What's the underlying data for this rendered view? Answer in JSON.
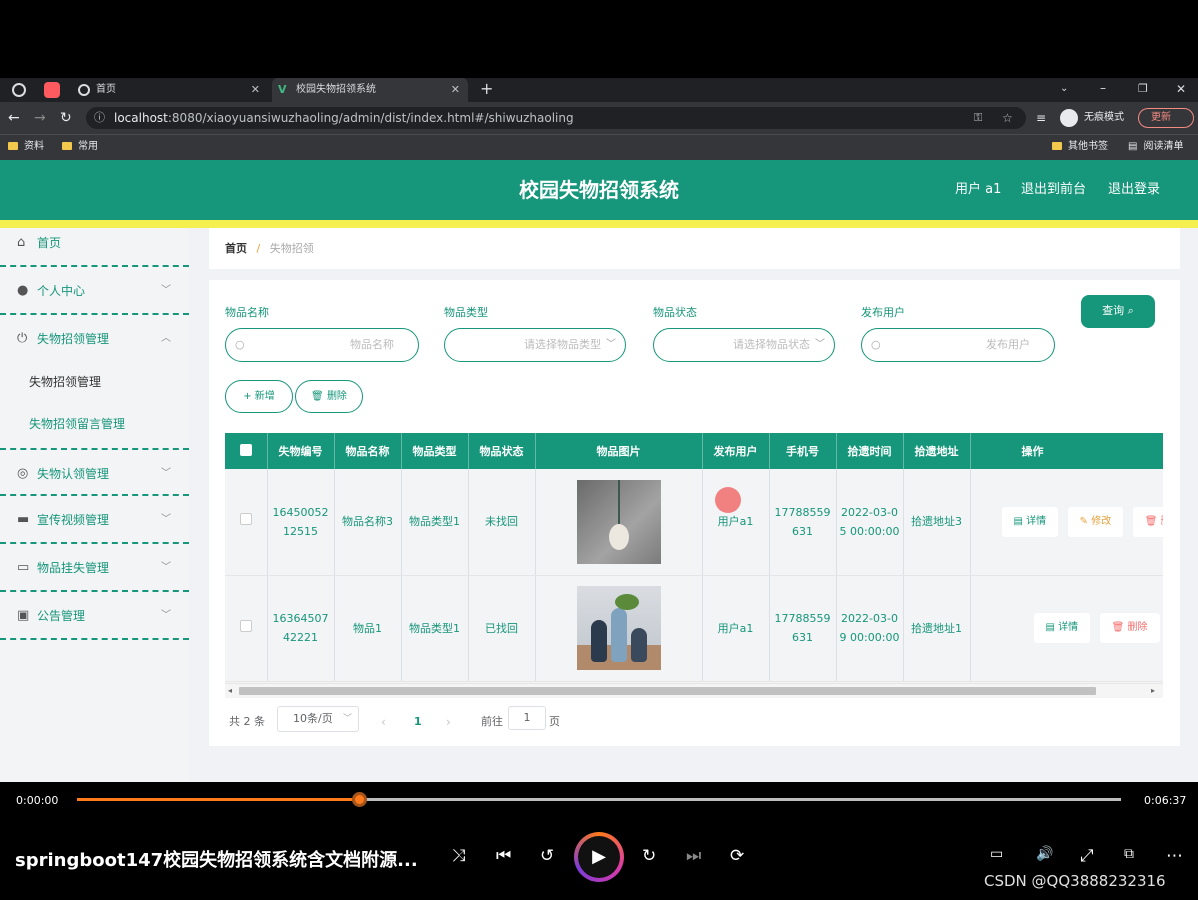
{
  "browser": {
    "tabs": [
      {
        "label": ""
      },
      {
        "label": ""
      },
      {
        "label": "首页"
      },
      {
        "label": "校园失物招领系统"
      }
    ],
    "url_host": "localhost",
    "url_path": ":8080/xiaoyuansiwuzhaoling/admin/dist/index.html#/shiwuzhaoling",
    "incognito_label": "无痕模式",
    "update_label": "更新",
    "bookmarks": [
      "资料",
      "常用"
    ],
    "other_bookmarks": "其他书签",
    "reading_list": "阅读清单"
  },
  "header": {
    "title": "校园失物招领系统",
    "user": "用户 a1",
    "back_front": "退出到前台",
    "logout": "退出登录"
  },
  "sidebar": {
    "items": [
      {
        "label": "首页",
        "icon": "home-icon"
      },
      {
        "label": "个人中心",
        "icon": "user-icon"
      },
      {
        "label": "失物招领管理",
        "icon": "power-icon"
      },
      {
        "label": "失物招领管理",
        "sub": true,
        "active": true
      },
      {
        "label": "失物招领留言管理",
        "sub": true
      },
      {
        "label": "失物认领管理",
        "icon": "target-icon"
      },
      {
        "label": "宣传视频管理",
        "icon": "video-icon"
      },
      {
        "label": "物品挂失管理",
        "icon": "card-icon"
      },
      {
        "label": "公告管理",
        "icon": "clipboard-icon"
      }
    ]
  },
  "breadcrumb": {
    "home": "首页",
    "sep": "/",
    "current": "失物招领"
  },
  "search": {
    "name_label": "物品名称",
    "name_placeholder": "物品名称",
    "type_label": "物品类型",
    "type_placeholder": "请选择物品类型",
    "status_label": "物品状态",
    "status_placeholder": "请选择物品状态",
    "user_label": "发布用户",
    "user_placeholder": "发布用户",
    "query": "查询"
  },
  "actions": {
    "add": "新增",
    "delete": "删除"
  },
  "table": {
    "columns": [
      "失物编号",
      "物品名称",
      "物品类型",
      "物品状态",
      "物品图片",
      "发布用户",
      "手机号",
      "拾遗时间",
      "拾遗地址",
      "操作"
    ],
    "rows": [
      {
        "id": "1645005212515",
        "name": "物品名称3",
        "type": "物品类型1",
        "status": "未找回",
        "user": "用户a1",
        "phone": "17788559631",
        "time": "2022-03-05 00:00:00",
        "addr": "拾遗地址3",
        "ops": [
          "详情",
          "修改",
          "删除"
        ]
      },
      {
        "id": "1636450742221",
        "name": "物品1",
        "type": "物品类型1",
        "status": "已找回",
        "user": "用户a1",
        "phone": "17788559631",
        "time": "2022-03-09 00:00:00",
        "addr": "拾遗地址1",
        "ops": [
          "详情",
          "删除"
        ]
      }
    ]
  },
  "pagination": {
    "total": "共 2 条",
    "size": "10条/页",
    "current": "1",
    "goto_prefix": "前往",
    "goto_value": "1",
    "goto_suffix": "页"
  },
  "player": {
    "current_time": "0:00:00",
    "total_time": "0:06:37",
    "progress": 0.27,
    "title": "springboot147校园失物招领系统含文档附源...",
    "watermark": "CSDN @QQ3888232316"
  },
  "colors": {
    "primary": "#16967a",
    "accent": "#f5ef4f",
    "progress": "#ff7a1a"
  }
}
